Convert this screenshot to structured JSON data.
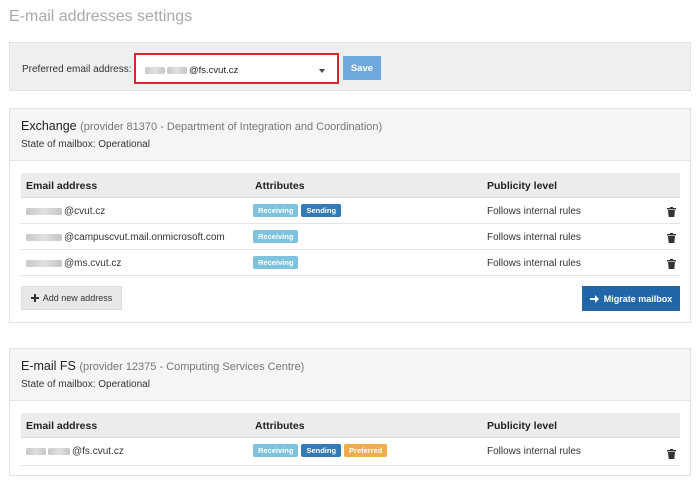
{
  "page": {
    "title": "E-mail addresses settings"
  },
  "preferred": {
    "label": "Preferred email address:",
    "selected_value": "@fs.cvut.cz",
    "save_label": "Save"
  },
  "exchange": {
    "title": "Exchange",
    "provider": "(provider 81370 - Department of Integration and Coordination)",
    "state": "State of mailbox: Operational",
    "columns": [
      "Email address",
      "Attributes",
      "Publicity level"
    ],
    "rows": [
      {
        "address": "@cvut.cz",
        "publicity": "Follows internal rules",
        "badges": [
          "Receiving",
          "Sending"
        ]
      },
      {
        "address": "@campuscvut.mail.onmicrosoft.com",
        "publicity": "Follows internal rules",
        "badges": [
          "Receiving"
        ]
      },
      {
        "address": "@ms.cvut.cz",
        "publicity": "Follows internal rules",
        "badges": [
          "Receiving"
        ]
      }
    ],
    "add_label": "Add new address",
    "migrate_label": "Migrate mailbox"
  },
  "emailfs": {
    "title": "E-mail FS",
    "provider": "(provider 12375 - Computing Services Centre)",
    "state": "State of mailbox: Operational",
    "columns": [
      "Email address",
      "Attributes",
      "Publicity level"
    ],
    "rows": [
      {
        "address": "@fs.cvut.cz",
        "publicity": "Follows internal rules",
        "badges": [
          "Receiving",
          "Sending",
          "Preferred"
        ]
      }
    ]
  },
  "colors": {
    "highlight": "#d9262b",
    "save": "#6fa8dc",
    "receiving": "#7dc3dd",
    "sending": "#337ab7",
    "preferred": "#f0ad4e",
    "migrate": "#2266aa"
  },
  "icons": {
    "delete": "trash-icon",
    "add": "plus-icon",
    "migrate": "arrow-right-icon",
    "dropdown": "caret-down-icon"
  }
}
